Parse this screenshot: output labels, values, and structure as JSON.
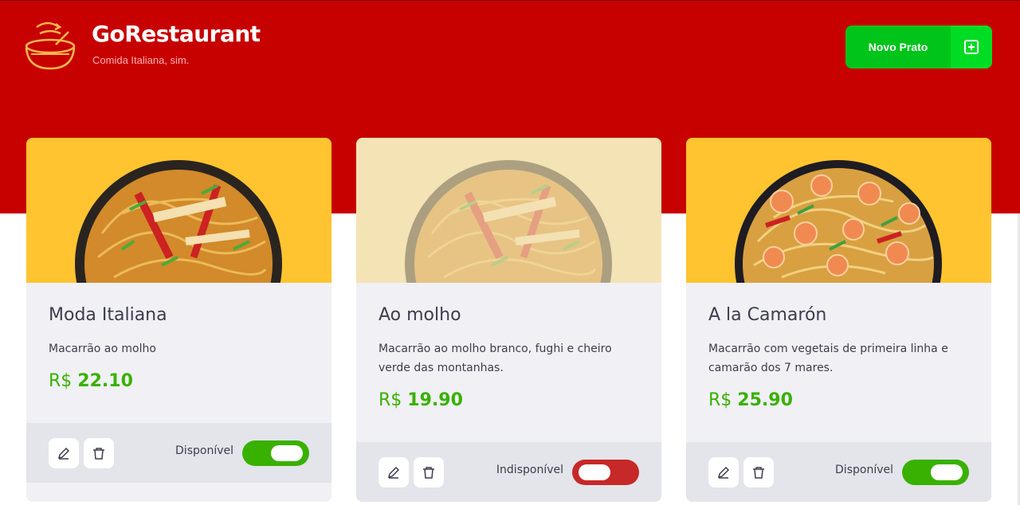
{
  "header": {
    "brand_name": "GoRestaurant",
    "brand_subtitle": "Comida Italiana, sim.",
    "new_button_label": "Novo Prato",
    "new_button_icon": "plus-square-icon"
  },
  "colors": {
    "header_red": "#c70000",
    "accent_green": "#39b100",
    "button_green": "#00c41a",
    "card_yellow": "#ffc42f",
    "unavailable_red": "#c72828"
  },
  "foods": [
    {
      "name": "Moda Italiana",
      "description": "Macarrão ao molho",
      "currency": "R$",
      "price": "22.10",
      "available": true,
      "status_label": "Disponível",
      "image": "chicken-pasta-bowl"
    },
    {
      "name": "Ao molho",
      "description": "Macarrão ao molho branco, fughi e cheiro verde das montanhas.",
      "currency": "R$",
      "price": "19.90",
      "available": false,
      "status_label": "Indisponível",
      "image": "chicken-pasta-bowl"
    },
    {
      "name": "A la Camarón",
      "description": "Macarrão com vegetais de primeira linha e camarão dos 7 mares.",
      "currency": "R$",
      "price": "25.90",
      "available": true,
      "status_label": "Disponível",
      "image": "shrimp-pasta-bowl"
    }
  ]
}
